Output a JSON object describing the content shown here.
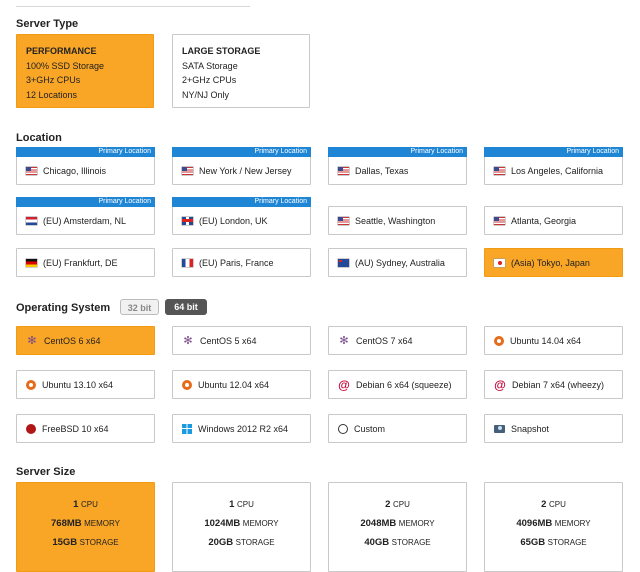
{
  "sections": {
    "server_type": "Server Type",
    "location": "Location",
    "os": "Operating System",
    "server_size": "Server Size"
  },
  "server_types": [
    {
      "title": "PERFORMANCE",
      "lines": [
        "100% SSD Storage",
        "3+GHz CPUs",
        "12 Locations"
      ],
      "selected": true
    },
    {
      "title": "LARGE STORAGE",
      "lines": [
        "SATA Storage",
        "2+GHz CPUs",
        "NY/NJ Only"
      ],
      "selected": false
    }
  ],
  "primary_label": "Primary Location",
  "locations": [
    {
      "name": "Chicago, Illinois",
      "flag": "us",
      "primary": true,
      "selected": false
    },
    {
      "name": "New York / New Jersey",
      "flag": "us",
      "primary": true,
      "selected": false
    },
    {
      "name": "Dallas, Texas",
      "flag": "us",
      "primary": true,
      "selected": false
    },
    {
      "name": "Los Angeles, California",
      "flag": "us",
      "primary": true,
      "selected": false
    },
    {
      "name": "(EU) Amsterdam, NL",
      "flag": "nl",
      "primary": true,
      "selected": false
    },
    {
      "name": "(EU) London, UK",
      "flag": "uk",
      "primary": true,
      "selected": false
    },
    {
      "name": "Seattle, Washington",
      "flag": "us",
      "primary": false,
      "selected": false
    },
    {
      "name": "Atlanta, Georgia",
      "flag": "us",
      "primary": false,
      "selected": false
    },
    {
      "name": "(EU) Frankfurt, DE",
      "flag": "de",
      "primary": false,
      "selected": false
    },
    {
      "name": "(EU) Paris, France",
      "flag": "fr",
      "primary": false,
      "selected": false
    },
    {
      "name": "(AU) Sydney, Australia",
      "flag": "au",
      "primary": false,
      "selected": false
    },
    {
      "name": "(Asia) Tokyo, Japan",
      "flag": "jp",
      "primary": false,
      "selected": true
    }
  ],
  "bit_toggle": {
    "bit32": "32 bit",
    "bit64": "64 bit",
    "active": "64"
  },
  "os_options": [
    {
      "name": "CentOS 6 x64",
      "icon": "centos-icon",
      "selected": true
    },
    {
      "name": "CentOS 5 x64",
      "icon": "centos-icon",
      "selected": false
    },
    {
      "name": "CentOS 7 x64",
      "icon": "centos-icon",
      "selected": false
    },
    {
      "name": "Ubuntu 14.04 x64",
      "icon": "ubuntu-icon",
      "selected": false
    },
    {
      "name": "Ubuntu 13.10 x64",
      "icon": "ubuntu-icon",
      "selected": false
    },
    {
      "name": "Ubuntu 12.04 x64",
      "icon": "ubuntu-icon",
      "selected": false
    },
    {
      "name": "Debian 6 x64 (squeeze)",
      "icon": "debian-icon",
      "selected": false
    },
    {
      "name": "Debian 7 x64 (wheezy)",
      "icon": "debian-icon",
      "selected": false
    },
    {
      "name": "FreeBSD 10 x64",
      "icon": "freebsd-icon",
      "selected": false
    },
    {
      "name": "Windows 2012 R2 x64",
      "icon": "windows-icon",
      "selected": false
    },
    {
      "name": "Custom",
      "icon": "iso-icon",
      "selected": false
    },
    {
      "name": "Snapshot",
      "icon": "camera-icon",
      "selected": false
    }
  ],
  "sizes": [
    {
      "cpu": "1",
      "cpu_unit": "CPU",
      "memory": "768MB",
      "memory_unit": "MEMORY",
      "storage": "15GB",
      "storage_unit": "STORAGE",
      "selected": true
    },
    {
      "cpu": "1",
      "cpu_unit": "CPU",
      "memory": "1024MB",
      "memory_unit": "MEMORY",
      "storage": "20GB",
      "storage_unit": "STORAGE",
      "selected": false
    },
    {
      "cpu": "2",
      "cpu_unit": "CPU",
      "memory": "2048MB",
      "memory_unit": "MEMORY",
      "storage": "40GB",
      "storage_unit": "STORAGE",
      "selected": false
    },
    {
      "cpu": "2",
      "cpu_unit": "CPU",
      "memory": "4096MB",
      "memory_unit": "MEMORY",
      "storage": "65GB",
      "storage_unit": "STORAGE",
      "selected": false
    }
  ],
  "colors": {
    "accent": "#f9a526",
    "primary_badge": "#1f86d6"
  }
}
